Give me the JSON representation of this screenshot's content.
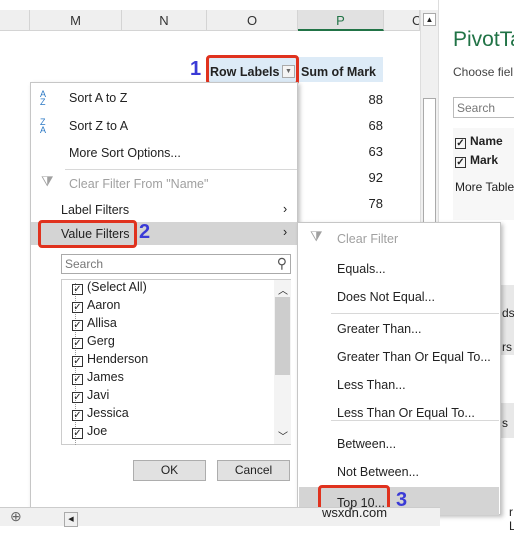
{
  "columns": [
    "M",
    "N",
    "O",
    "P",
    "C"
  ],
  "pivot": {
    "row_labels": "Row Labels",
    "sum_header": "Sum of Mark",
    "values": [
      "88",
      "68",
      "63",
      "92",
      "78"
    ]
  },
  "menu": {
    "sort_az": "Sort A to Z",
    "sort_za": "Sort Z to A",
    "more_sort": "More Sort Options...",
    "clear_filter": "Clear Filter From \"Name\"",
    "label_filters": "Label Filters",
    "value_filters": "Value Filters",
    "search_placeholder": "Search",
    "items": [
      "(Select All)",
      "Aaron",
      "Allisa",
      "Gerg",
      "Henderson",
      "James",
      "Javi",
      "Jessica",
      "Joe"
    ],
    "ok": "OK",
    "cancel": "Cancel"
  },
  "submenu": {
    "clear": "Clear Filter",
    "items": [
      "Equals...",
      "Does Not Equal...",
      "Greater Than...",
      "Greater Than Or Equal To...",
      "Less Than...",
      "Less Than Or Equal To...",
      "Between...",
      "Not Between...",
      "Top 10..."
    ]
  },
  "steps": [
    "1",
    "2",
    "3"
  ],
  "pane": {
    "title": "PivotTa",
    "choose": "Choose fiel",
    "search": "Search",
    "fields": [
      "Name",
      "Mark"
    ],
    "more": "More Table",
    "frag1": "ds",
    "frag2": "rs",
    "frag3": "s",
    "frag4": "r L"
  },
  "watermark": "wsxdn.com",
  "colors": {
    "accent": "#217346",
    "highlight": "#e0321e",
    "step": "#3a3ad6"
  }
}
